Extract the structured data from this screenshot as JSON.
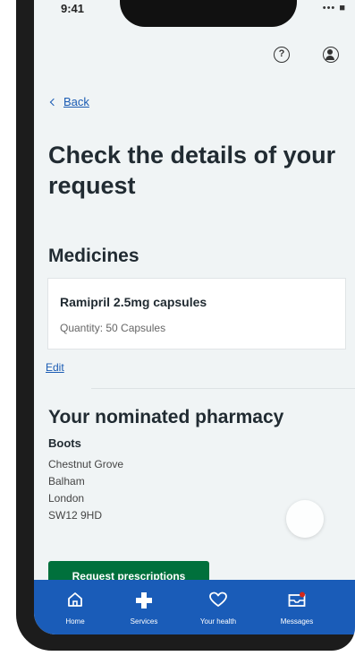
{
  "status_bar": {
    "time": "9:41",
    "indicators": "••• ■"
  },
  "header": {
    "help_icon": "help-circle-icon",
    "account_icon": "account-icon"
  },
  "navigation": {
    "back_label": "Back"
  },
  "page": {
    "title": "Check the details of your request"
  },
  "medicines": {
    "heading": "Medicines",
    "items": [
      {
        "name": "Ramipril 2.5mg capsules",
        "quantity": "Quantity: 50 Capsules"
      }
    ],
    "edit_label": "Edit"
  },
  "pharmacy": {
    "heading": "Your nominated pharmacy",
    "name": "Boots",
    "address": [
      "Chestnut Grove",
      "Balham",
      "London",
      "SW12 9HD"
    ]
  },
  "actions": {
    "submit_label": "Request prescriptions"
  },
  "tab_bar": {
    "tabs": [
      {
        "label": "Home",
        "icon": "home-icon"
      },
      {
        "label": "Services",
        "icon": "plus-icon"
      },
      {
        "label": "Your health",
        "icon": "heart-icon"
      },
      {
        "label": "Messages",
        "icon": "envelope-icon"
      }
    ]
  },
  "colors": {
    "brand_blue": "#1a5cb8",
    "link_blue": "#1a5bb3",
    "primary_green": "#00703c",
    "page_background": "#f0f4f5",
    "text_dark": "#212b32"
  }
}
